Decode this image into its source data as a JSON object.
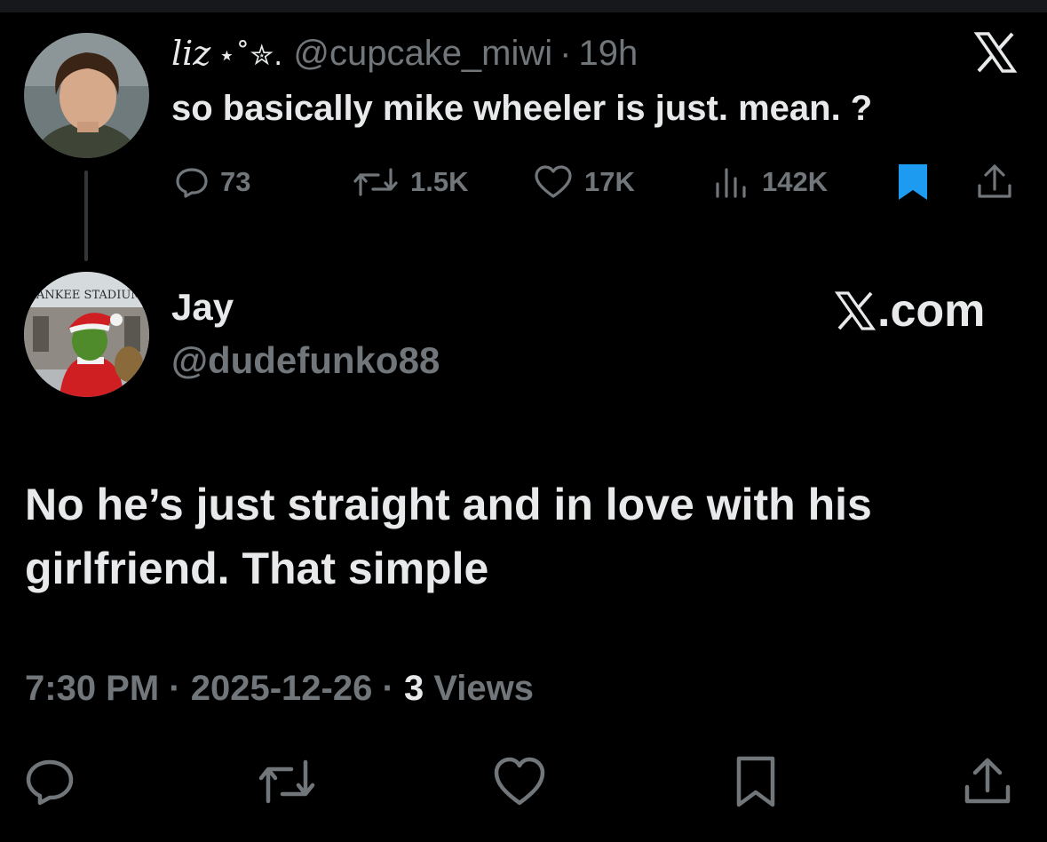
{
  "quoted_tweet": {
    "display_name": "liz",
    "name_decoration": "⋆˚✮.",
    "handle": "@cupcake_miwi",
    "separator": "·",
    "age": "19h",
    "text": "so basically mike wheeler is just. mean. ?",
    "metrics": {
      "replies": "73",
      "reposts": "1.5K",
      "likes": "17K",
      "views": "142K"
    },
    "bookmarked": true
  },
  "main_tweet": {
    "display_name": "Jay",
    "handle": "@dudefunko88",
    "site_label": ".com",
    "avatar_banner": "YANKEE STADIUM",
    "text": "No he’s just straight and in love with his girlfriend. That simple",
    "time": "7:30 PM",
    "date": "2025-12-26",
    "separator": "·",
    "views_count": "3",
    "views_label": "Views"
  },
  "colors": {
    "background": "#000000",
    "primary_text": "#e7e9ea",
    "secondary_text": "#71767b",
    "bookmark_accent": "#1d9bf0"
  },
  "icons": [
    "reply-icon",
    "repost-icon",
    "like-icon",
    "views-icon",
    "bookmark-icon",
    "share-icon",
    "x-logo-icon"
  ]
}
